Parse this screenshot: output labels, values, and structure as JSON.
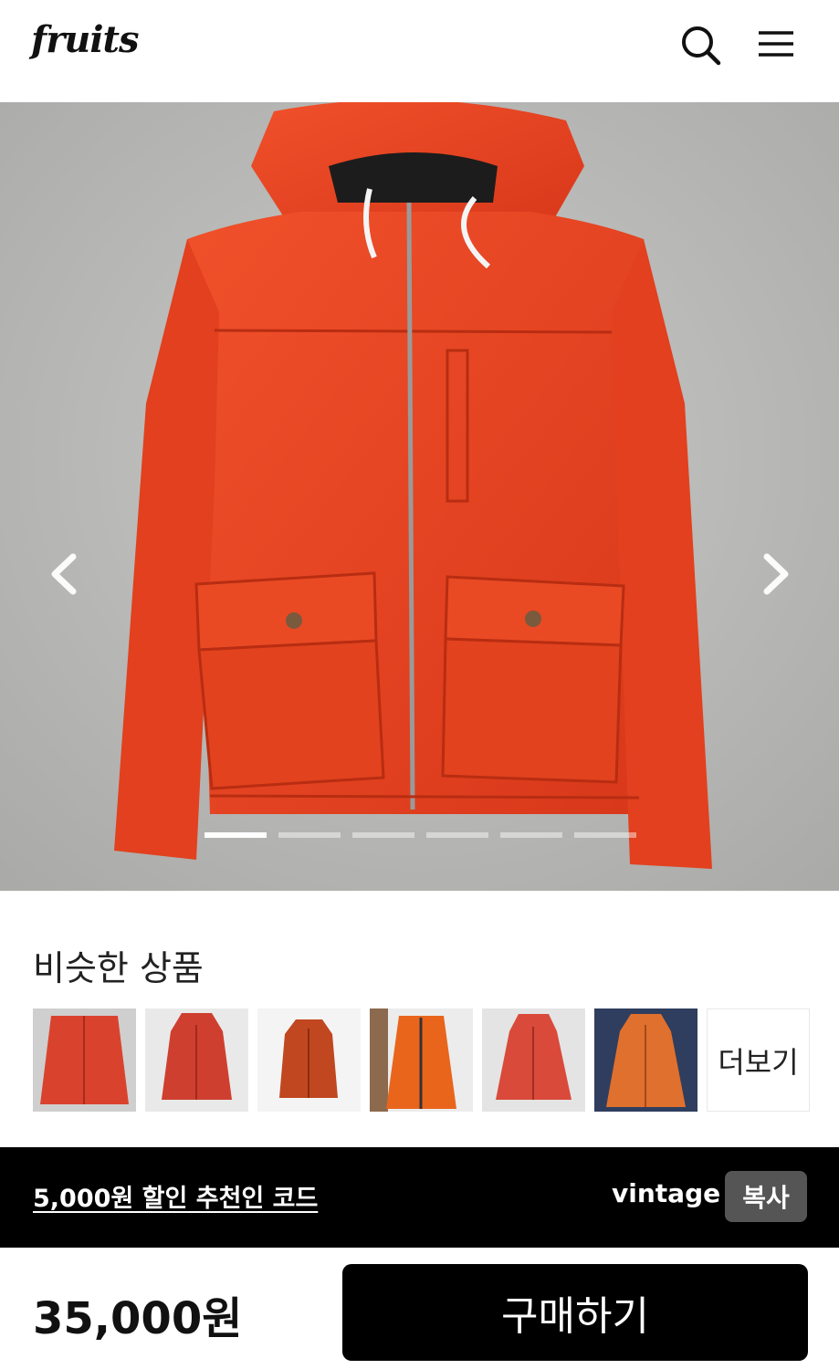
{
  "header": {
    "logo": "fruits",
    "search_icon": "search-icon",
    "menu_icon": "hamburger-menu-icon"
  },
  "gallery": {
    "image": "orange hooded zip jacket on hanger",
    "prev_icon": "chevron-left-icon",
    "next_icon": "chevron-right-icon",
    "total_slides": 6,
    "active_slide": 1
  },
  "similar": {
    "title": "비슷한 상품",
    "items": [
      {
        "image": "red zip jacket",
        "color": "#d9432e"
      },
      {
        "image": "red hooded jacket",
        "color": "#cf3f2f"
      },
      {
        "image": "rust hooded jacket",
        "color": "#c0471f"
      },
      {
        "image": "orange zip jacket",
        "color": "#e9651c"
      },
      {
        "image": "red hooded jacket with buttons",
        "color": "#d94a3a"
      },
      {
        "image": "orange field jacket",
        "color": "#e0702e"
      }
    ],
    "more_label": "더보기"
  },
  "promo": {
    "link_text": "5,000원 할인 추천인 코드",
    "code": "vintage",
    "copy_label": "복사"
  },
  "purchase": {
    "price": "35,000원",
    "buy_label": "구매하기"
  },
  "colors": {
    "jacket": "#e8431c",
    "background_wall": "#b9b9b7",
    "promo_bar": "#000000",
    "copy_button": "#555555"
  }
}
